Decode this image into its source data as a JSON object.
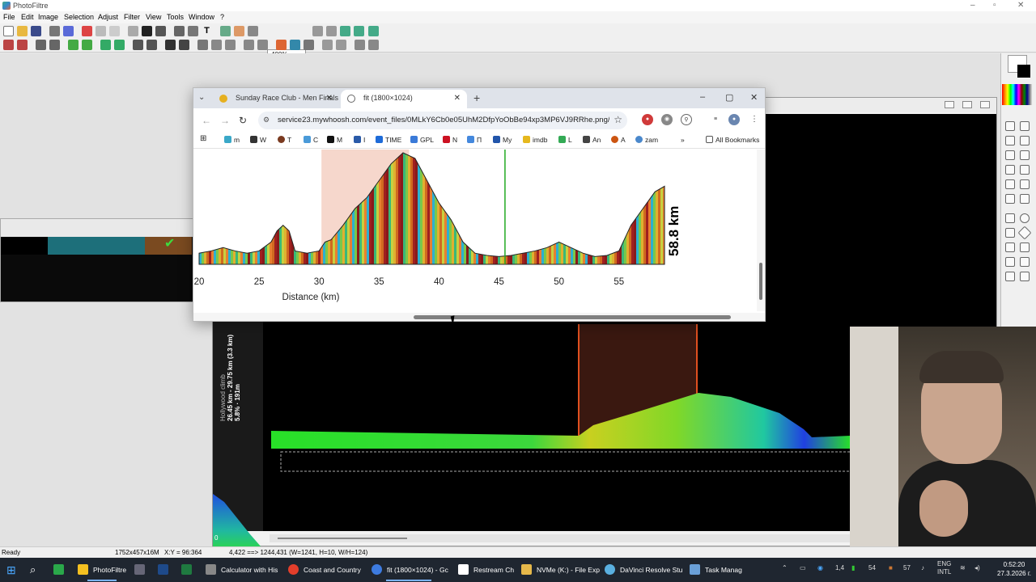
{
  "photofiltre": {
    "title": "PhotoFiltre",
    "menu": [
      "File",
      "Edit",
      "Image",
      "Selection",
      "Adjust",
      "Filter",
      "View",
      "Tools",
      "Window",
      "?"
    ],
    "zoom": "400%",
    "status": {
      "ready": "Ready",
      "size": "1752x457x16M",
      "xy": "X:Y = 96:364",
      "selection": "4,422 ==> 1244,431 (W=1241, H=10, W/H=124)"
    },
    "climb_label": {
      "name": "Hollywood climb",
      "range": "26.45 km - 29.75 km (3.3 km)",
      "stats": "5.8% · 191m"
    },
    "side_zero": "0"
  },
  "chrome": {
    "tabs": [
      {
        "label": "Sunday Race Club - Men Finals",
        "active": false
      },
      {
        "label": "fit (1800×1024)",
        "active": true
      }
    ],
    "url": "service23.mywhoosh.com/event_files/0MLkY6Cb0e05UhM2DfpYoObBe94xp3MP6VJ9RRhe.png/18...",
    "bookmarks": [
      {
        "label": "m",
        "color": "#3aa8c8"
      },
      {
        "label": "W",
        "color": "#333333"
      },
      {
        "label": "T",
        "color": "#7a3a20"
      },
      {
        "label": "C",
        "color": "#4a9ad8"
      },
      {
        "label": "M",
        "color": "#111111"
      },
      {
        "label": "I",
        "color": "#2a5aa8"
      },
      {
        "label": "TIME",
        "color": "#1e6bd8"
      },
      {
        "label": "GPL",
        "color": "#3a7ad8"
      },
      {
        "label": "N",
        "color": "#cc1122"
      },
      {
        "label": "П",
        "color": "#4488dd"
      },
      {
        "label": "My",
        "color": "#2255aa"
      },
      {
        "label": "imdb",
        "color": "#e6b81e"
      },
      {
        "label": "L",
        "color": "#33aa55"
      },
      {
        "label": "An",
        "color": "#444444"
      },
      {
        "label": "A",
        "color": "#cc5511"
      },
      {
        "label": "zam",
        "color": "#4a88cc"
      }
    ],
    "all_bookmarks": "All Bookmarks"
  },
  "chart_data": {
    "type": "area",
    "xlabel": "Distance (km)",
    "ylabel": "",
    "title": "",
    "x_ticks": [
      20,
      25,
      30,
      35,
      40,
      45,
      50,
      55
    ],
    "xlim": [
      20,
      59
    ],
    "total_label": "58.8 km",
    "highlight_band": [
      30.2,
      37.5
    ],
    "marker_line_x": 45.5,
    "profile": {
      "x": [
        20,
        21,
        22,
        23,
        24,
        25,
        26,
        26.5,
        27,
        27.5,
        28,
        29,
        30,
        30.5,
        31,
        32,
        33,
        34,
        35,
        36,
        37,
        38,
        39,
        40,
        41,
        42,
        43,
        44,
        45,
        46,
        47,
        48,
        49,
        50,
        51,
        52,
        53,
        54,
        55,
        56,
        57,
        58,
        58.8
      ],
      "y": [
        0.1,
        0.12,
        0.15,
        0.12,
        0.1,
        0.12,
        0.2,
        0.3,
        0.35,
        0.3,
        0.12,
        0.1,
        0.12,
        0.2,
        0.22,
        0.35,
        0.5,
        0.6,
        0.75,
        0.9,
        1.0,
        0.95,
        0.75,
        0.55,
        0.4,
        0.2,
        0.1,
        0.08,
        0.07,
        0.08,
        0.1,
        0.12,
        0.15,
        0.2,
        0.15,
        0.1,
        0.07,
        0.08,
        0.12,
        0.35,
        0.5,
        0.65,
        0.7
      ]
    }
  },
  "taskbar": {
    "items": [
      {
        "label": "PhotoFiltre",
        "color": "#f4c020"
      },
      {
        "label": "Calculator with His",
        "color": "#888888"
      },
      {
        "label": "Coast and Country",
        "color": "#e33e2b"
      },
      {
        "label": "fit (1800×1024) - Gc",
        "color": "#3d7be0"
      },
      {
        "label": "Restream Ch",
        "color": "#ffffff"
      },
      {
        "label": "NVMe (K:) - File Exp",
        "color": "#e6b84a"
      },
      {
        "label": "DaVinci Resolve Stu",
        "color": "#5ab0e0"
      },
      {
        "label": "Task Manag",
        "color": "#6aa0d8"
      }
    ],
    "tray": {
      "lang": "ENG",
      "intl": "INTL",
      "n1": "1,4",
      "n2": "54",
      "n3": "57",
      "time": "0:52:20",
      "date": "27.3.2026 г."
    }
  }
}
